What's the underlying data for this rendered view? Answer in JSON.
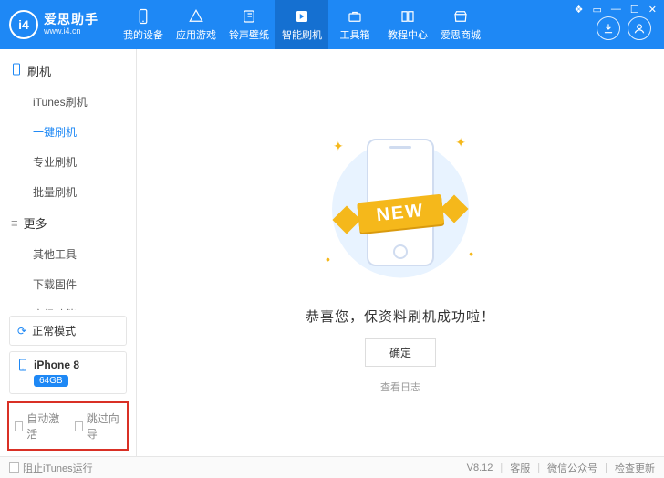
{
  "app": {
    "logo_badge": "i4",
    "logo_cn": "爱思助手",
    "logo_url": "www.i4.cn"
  },
  "nav": {
    "items": [
      {
        "id": "device",
        "label": "我的设备"
      },
      {
        "id": "apps",
        "label": "应用游戏"
      },
      {
        "id": "ringtone",
        "label": "铃声壁纸"
      },
      {
        "id": "flash",
        "label": "智能刷机"
      },
      {
        "id": "tools",
        "label": "工具箱"
      },
      {
        "id": "tutorial",
        "label": "教程中心"
      },
      {
        "id": "mall",
        "label": "爱思商城"
      }
    ],
    "active": "flash"
  },
  "window_controls": {
    "skin": "❖",
    "lock": "▭",
    "min": "—",
    "max": "☐",
    "close": "✕"
  },
  "sidebar": {
    "group1": {
      "title": "刷机",
      "items": [
        {
          "id": "itunes",
          "label": "iTunes刷机"
        },
        {
          "id": "onekey",
          "label": "一键刷机"
        },
        {
          "id": "pro",
          "label": "专业刷机"
        },
        {
          "id": "batch",
          "label": "批量刷机"
        }
      ],
      "active": "onekey"
    },
    "group2": {
      "title": "更多",
      "items": [
        {
          "id": "other",
          "label": "其他工具"
        },
        {
          "id": "download",
          "label": "下载固件"
        },
        {
          "id": "adv",
          "label": "高级功能"
        }
      ]
    },
    "mode": {
      "label": "正常模式"
    },
    "device": {
      "name": "iPhone 8",
      "storage": "64GB"
    },
    "redbox": {
      "auto_activate": "自动激活",
      "skip_wizard": "跳过向导"
    }
  },
  "main": {
    "ribbon": "NEW",
    "title": "恭喜您，保资料刷机成功啦！",
    "confirm": "确定",
    "log": "查看日志"
  },
  "footer": {
    "block_itunes": "阻止iTunes运行",
    "version": "V8.12",
    "support": "客服",
    "wechat": "微信公众号",
    "update": "检查更新"
  }
}
